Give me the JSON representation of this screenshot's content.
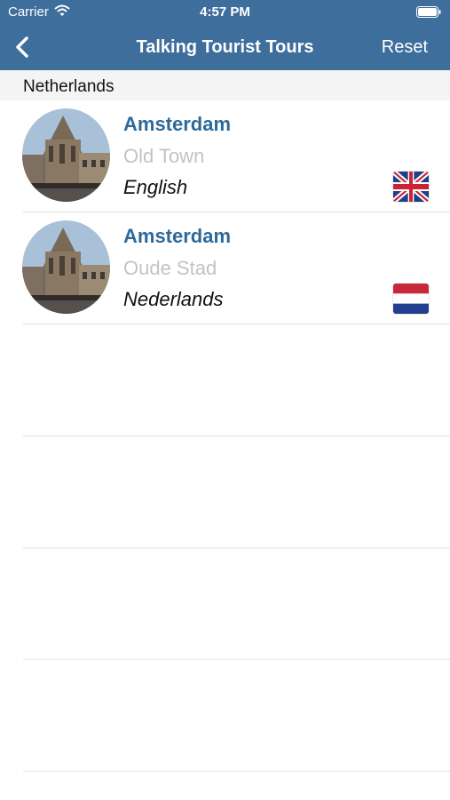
{
  "status_bar": {
    "carrier": "Carrier",
    "time": "4:57 PM"
  },
  "nav": {
    "title": "Talking Tourist Tours",
    "reset_label": "Reset",
    "back_icon": "chevron-left-icon"
  },
  "section": {
    "title": "Netherlands"
  },
  "tours": [
    {
      "city": "Amsterdam",
      "area": "Old Town",
      "language": "English",
      "flag": "uk-flag-icon"
    },
    {
      "city": "Amsterdam",
      "area": "Oude Stad",
      "language": "Nederlands",
      "flag": "netherlands-flag-icon"
    }
  ],
  "colors": {
    "nav_background": "#3e6e9b",
    "city_text": "#2d6a9b",
    "area_text": "#c3c3c3",
    "section_background": "#f4f4f4"
  }
}
